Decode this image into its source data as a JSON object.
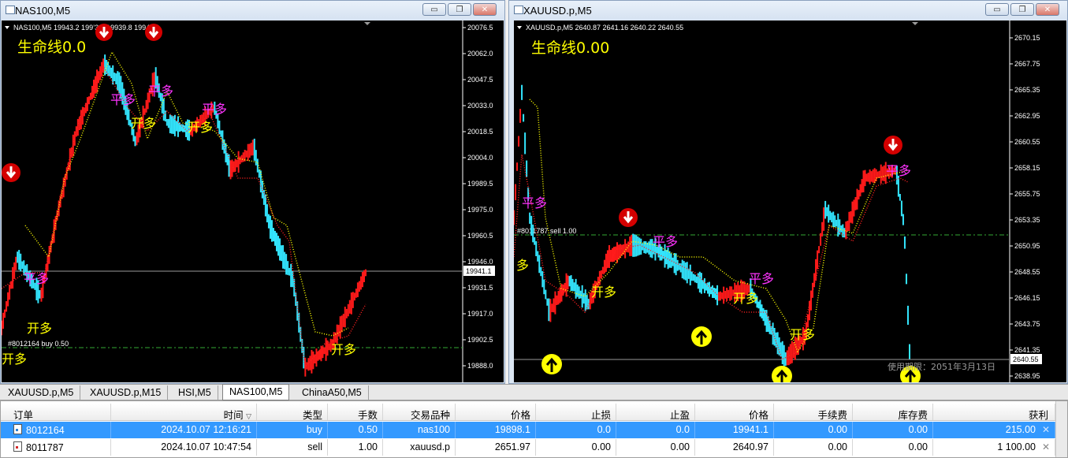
{
  "left_window": {
    "title": "NAS100,M5",
    "info": "NAS100,M5  19943.2 199’3.5 19939.8 19941.1",
    "overlay_label": "生命线0.0",
    "price_ticks": [
      "20076.5",
      "20062.0",
      "20047.5",
      "20033.0",
      "20018.5",
      "20004.0",
      "19989.5",
      "19975.0",
      "19960.5",
      "19946.0",
      "19931.5",
      "19917.0",
      "19902.5",
      "19888.0"
    ],
    "current_price": "19941.1",
    "order_line_label": "#8012164 buy 0.50",
    "signals": {
      "close_long": "平多",
      "open_long": "开多"
    }
  },
  "right_window": {
    "title": "XAUUSD.p,M5",
    "info": "XAUUSD.p,M5  2640.87 2641.16 2640.22 2640.55",
    "overlay_label": "生命线0.00",
    "price_ticks": [
      "2670.15",
      "2667.75",
      "2665.35",
      "2662.95",
      "2660.55",
      "2658.15",
      "2655.75",
      "2653.35",
      "2650.95",
      "2648.55",
      "2646.15",
      "2643.75",
      "2641.35",
      "2638.95"
    ],
    "current_price": "2640.55",
    "order_line_label": "#8011787 sell 1.00",
    "license_text": "使用期限：2051年3月13日",
    "signals": {
      "close_long": "平多",
      "open_long": "开多",
      "long": "多"
    }
  },
  "window_buttons": {
    "minimize": "▭",
    "restore": "❐",
    "close": "✕"
  },
  "tabs": [
    "XAUUSD.p,M5",
    "XAUUSD.p,M15",
    "HSI,M5",
    "NAS100,M5",
    "ChinaA50,M5"
  ],
  "active_tab": "NAS100,M5",
  "orders": {
    "columns": [
      "订单",
      "时间",
      "类型",
      "手数",
      "交易品种",
      "价格",
      "止损",
      "止盈",
      "价格",
      "手续费",
      "库存费",
      "获利"
    ],
    "sort_indicator": "▽",
    "rows": [
      {
        "ticket": "8012164",
        "time": "2024.10.07 12:16:21",
        "type": "buy",
        "lots": "0.50",
        "symbol": "nas100",
        "open_price": "19898.1",
        "sl": "0.0",
        "tp": "0.0",
        "price": "19941.1",
        "commission": "0.00",
        "swap": "0.00",
        "profit": "215.00"
      },
      {
        "ticket": "8011787",
        "time": "2024.10.07 10:47:54",
        "type": "sell",
        "lots": "1.00",
        "symbol": "xauusd.p",
        "open_price": "2651.97",
        "sl": "0.00",
        "tp": "0.00",
        "price": "2640.97",
        "commission": "0.00",
        "swap": "0.00",
        "profit": "1 100.00"
      }
    ]
  },
  "colors": {
    "chart_bg": "#000000",
    "bull": "#ff0000",
    "bear": "#33e6ff",
    "signal": "#ffff00",
    "magenta": "#ff33ff",
    "order_line": "#33aa33",
    "selection": "#3399ff"
  }
}
